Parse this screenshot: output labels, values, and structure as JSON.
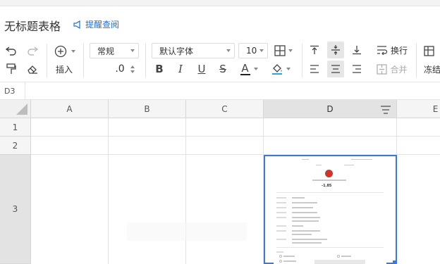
{
  "header": {
    "doc_title": "无标题表格",
    "reminder_label": "提醒查阅"
  },
  "toolbar": {
    "insert_label": "插入",
    "number_format": "常规",
    "decimal_label": ".0",
    "font_family": "默认字体",
    "font_size": "10",
    "bold": "B",
    "italic": "I",
    "underline": "U",
    "strikethrough": "S",
    "font_color": "A",
    "wrap_label": "换行",
    "merge_label": "合并",
    "freeze_label": "冻结"
  },
  "formula_bar": {
    "cell_ref": "D3"
  },
  "sheet": {
    "columns": [
      "A",
      "B",
      "C",
      "D",
      "E"
    ],
    "rows": [
      "1",
      "2",
      "3"
    ],
    "selected_cell": "D3",
    "embedded_image_amount": "-1.85"
  },
  "colors": {
    "accent": "#3d7ad6",
    "link": "#1f6fd1"
  }
}
